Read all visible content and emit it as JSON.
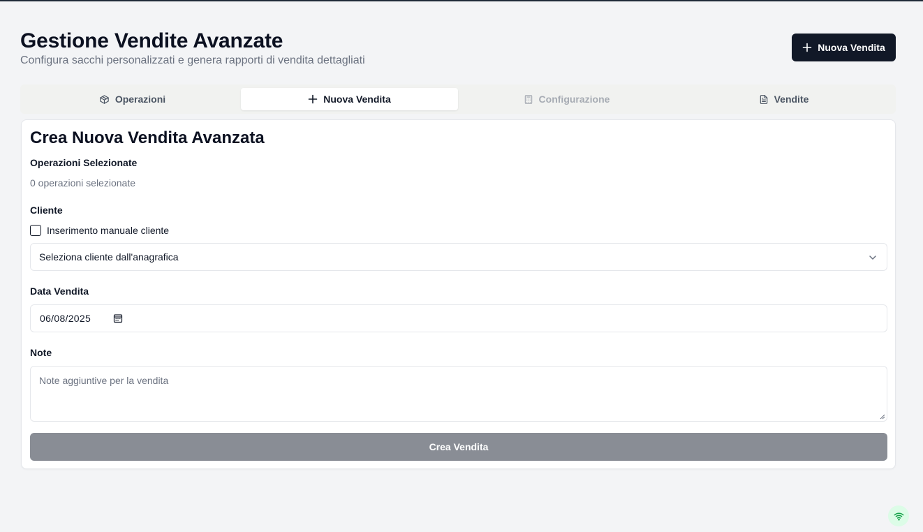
{
  "header": {
    "title": "Gestione Vendite Avanzate",
    "subtitle": "Configura sacchi personalizzati e genera rapporti di vendita dettagliati",
    "new_sale_button": "Nuova Vendita",
    "new_sale_icon": "plus-icon"
  },
  "tabs": [
    {
      "label": "Operazioni",
      "icon": "package-icon",
      "state": "normal"
    },
    {
      "label": "Nuova Vendita",
      "icon": "plus-icon",
      "state": "active"
    },
    {
      "label": "Configurazione",
      "icon": "calculator-icon",
      "state": "disabled"
    },
    {
      "label": "Vendite",
      "icon": "file-text-icon",
      "state": "normal"
    }
  ],
  "form": {
    "title": "Crea Nuova Vendita Avanzata",
    "operations_label": "Operazioni Selezionate",
    "operations_count_text": "0 operazioni selezionate",
    "client_label": "Cliente",
    "manual_client_checkbox_label": "Inserimento manuale cliente",
    "manual_client_checked": false,
    "client_select_value": "Seleziona cliente dall'anagrafica",
    "date_label": "Data Vendita",
    "date_value": "06/08/2025",
    "notes_label": "Note",
    "notes_placeholder": "Note aggiuntive per la vendita",
    "submit_label": "Crea Vendita",
    "submit_enabled": false
  },
  "status": {
    "connection_icon": "wifi-icon",
    "connection_color": "#16a34a"
  },
  "colors": {
    "primary": "#111827",
    "background": "#f3f4f6",
    "disabled_button": "#898d95"
  }
}
